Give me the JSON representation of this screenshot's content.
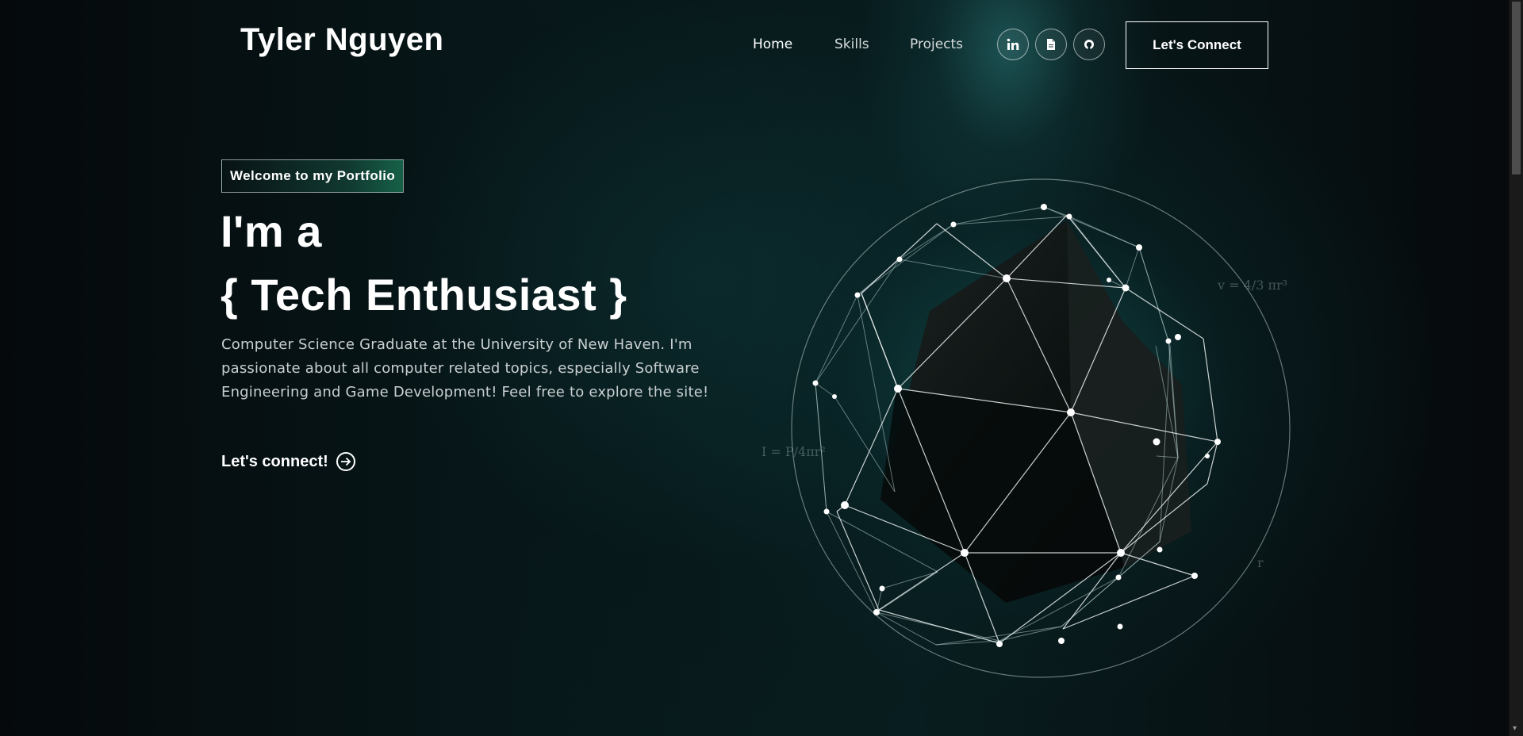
{
  "header": {
    "logo": "Tyler Nguyen",
    "nav": [
      "Home",
      "Skills",
      "Projects"
    ],
    "social_icons": [
      "linkedin-icon",
      "document-icon",
      "github-icon"
    ],
    "connect_button": "Let's Connect"
  },
  "hero": {
    "tagline": "Welcome to my Portfolio",
    "headline_line1": "I'm a",
    "headline_line2": "{ Tech Enthusiast }",
    "bio": "Computer Science Graduate at the University of New Haven. I'm passionate about all computer related topics, especially Software Engineering and Game Development! Feel free to explore the site!",
    "cta_label": "Let's connect!",
    "cta_icon": "arrow-right-circle-icon"
  },
  "art": {
    "formula_volume": "v = 4/3 πr³",
    "formula_intensity": "I = P/4πr²",
    "formula_radius": "r"
  },
  "colors": {
    "background": "#05090b",
    "accent_teal": "#125656",
    "tagline_green": "#196e50",
    "text_muted": "#c9cfd1"
  }
}
